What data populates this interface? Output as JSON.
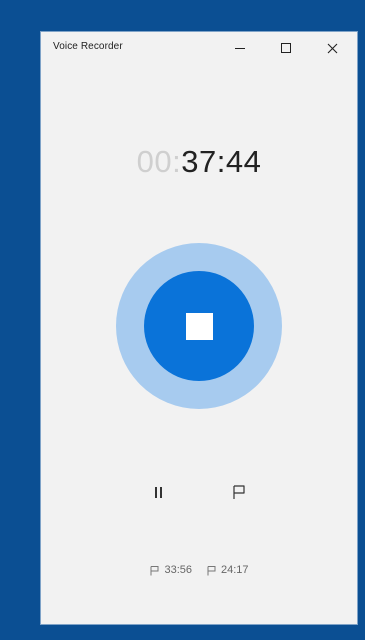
{
  "window": {
    "title": "Voice Recorder"
  },
  "timer": {
    "hours": "00",
    "separator": ":",
    "minutes_seconds": "37:44"
  },
  "controls": {
    "record": {
      "icon": "stop-icon"
    },
    "pause": {
      "icon": "pause-icon"
    },
    "flag": {
      "icon": "flag-icon"
    }
  },
  "markers": [
    {
      "icon": "flag-icon",
      "time": "33:56"
    },
    {
      "icon": "flag-icon",
      "time": "24:17"
    }
  ],
  "colors": {
    "frame": "#0b4f93",
    "window_bg": "#f2f2f2",
    "record_outer": "#a7cbef",
    "record_inner": "#0a73d9",
    "timer_dim": "#cfcfcf",
    "timer_active": "#222222"
  }
}
